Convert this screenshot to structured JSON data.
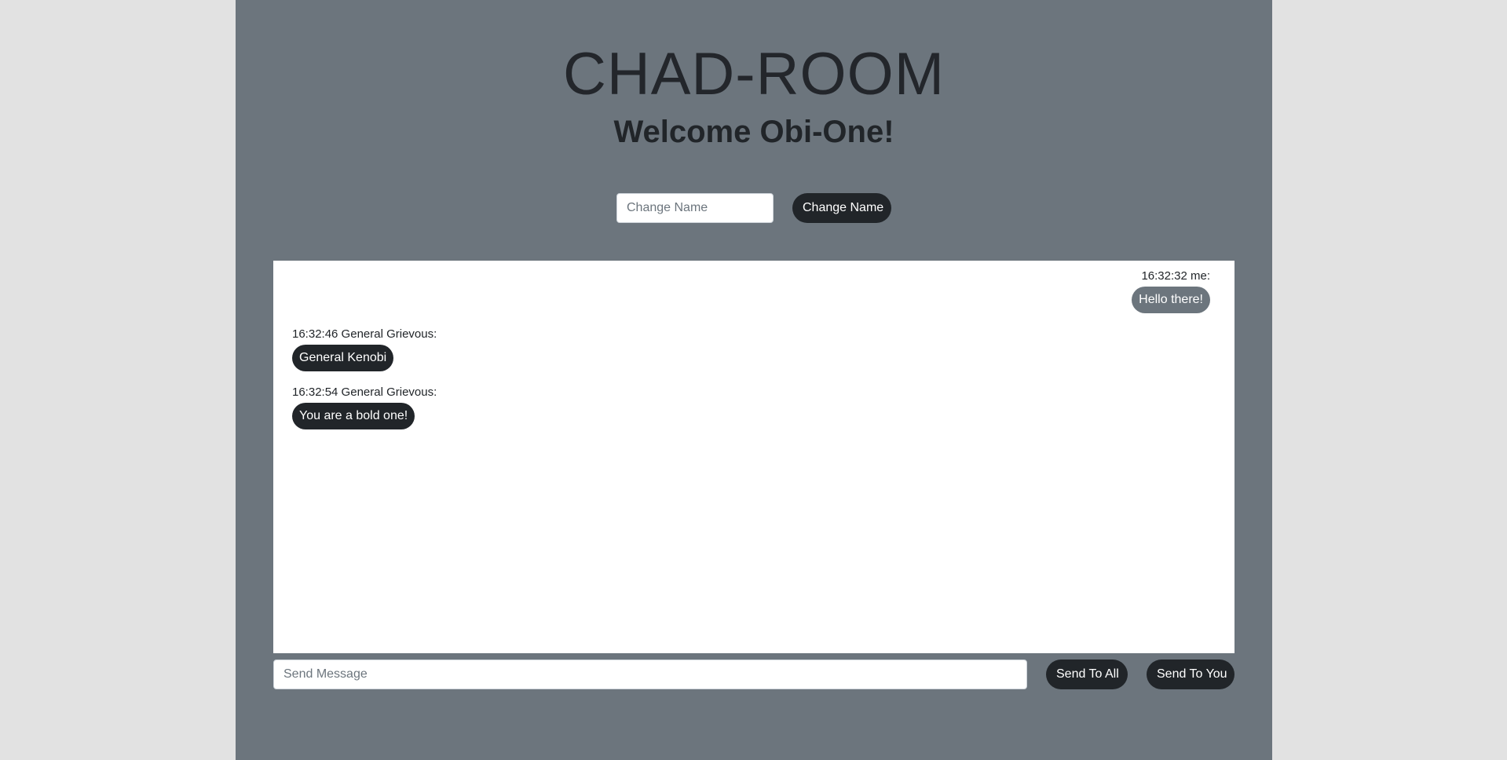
{
  "header": {
    "app_title": "CHAD-ROOM",
    "welcome_text": "Welcome Obi-One!"
  },
  "name_form": {
    "placeholder": "Change Name",
    "value": "",
    "button_label": "Change Name"
  },
  "messages": [
    {
      "time": "16:32:32",
      "sender": "me",
      "meta": "16:32:32 me:",
      "text": "Hello there!",
      "align": "right",
      "bubble_color": "#6c757d"
    },
    {
      "time": "16:32:46",
      "sender": "General Grievous",
      "meta": "16:32:46 General Grievous:",
      "text": "General Kenobi",
      "align": "left",
      "bubble_color": "#212529"
    },
    {
      "time": "16:32:54",
      "sender": "General Grievous",
      "meta": "16:32:54 General Grievous:",
      "text": "You are a bold one!",
      "align": "left",
      "bubble_color": "#212529"
    }
  ],
  "composer": {
    "placeholder": "Send Message",
    "value": "",
    "send_all_label": "Send To All",
    "send_you_label": "Send To You"
  },
  "colors": {
    "background": "#e2e2e2",
    "page": "#6c757d",
    "button": "#212529",
    "chat_panel": "#ffffff"
  }
}
